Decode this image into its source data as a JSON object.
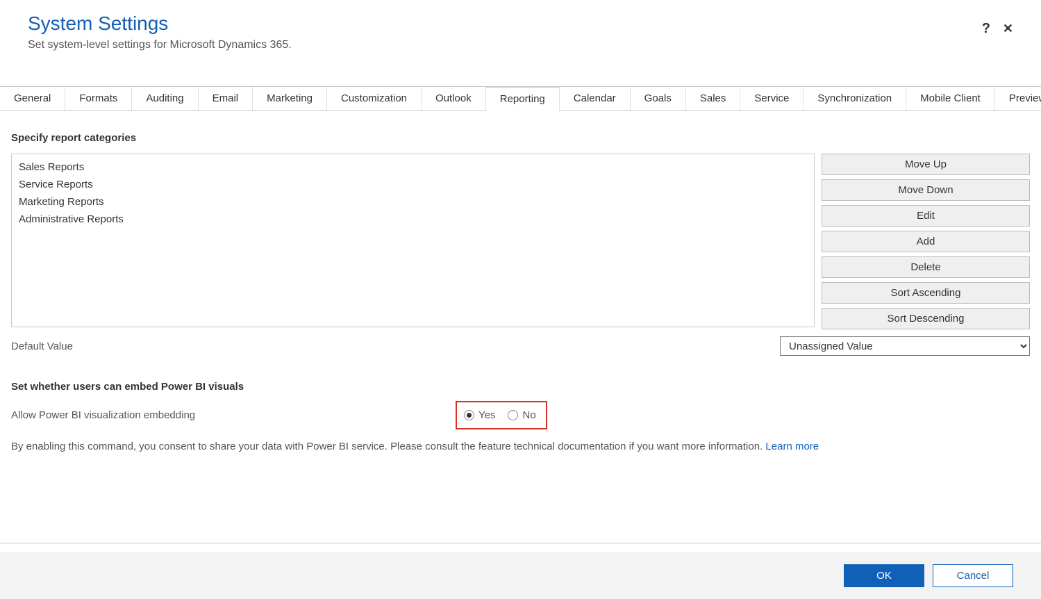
{
  "header": {
    "title": "System Settings",
    "subtitle": "Set system-level settings for Microsoft Dynamics 365.",
    "help": "?",
    "close": "✕"
  },
  "tabs": [
    {
      "label": "General"
    },
    {
      "label": "Formats"
    },
    {
      "label": "Auditing"
    },
    {
      "label": "Email"
    },
    {
      "label": "Marketing"
    },
    {
      "label": "Customization"
    },
    {
      "label": "Outlook"
    },
    {
      "label": "Reporting",
      "active": true
    },
    {
      "label": "Calendar"
    },
    {
      "label": "Goals"
    },
    {
      "label": "Sales"
    },
    {
      "label": "Service"
    },
    {
      "label": "Synchronization"
    },
    {
      "label": "Mobile Client"
    },
    {
      "label": "Previews"
    }
  ],
  "report": {
    "heading": "Specify report categories",
    "items": [
      "Sales Reports",
      "Service Reports",
      "Marketing Reports",
      "Administrative Reports"
    ],
    "buttons": {
      "move_up": "Move Up",
      "move_down": "Move Down",
      "edit": "Edit",
      "add": "Add",
      "delete": "Delete",
      "sort_asc": "Sort Ascending",
      "sort_desc": "Sort Descending"
    },
    "default_label": "Default Value",
    "default_value": "Unassigned Value"
  },
  "powerbi": {
    "heading": "Set whether users can embed Power BI visuals",
    "label": "Allow Power BI visualization embedding",
    "yes": "Yes",
    "no": "No",
    "selected": "yes",
    "consent": "By enabling this command, you consent to share your data with Power BI service. Please consult the feature technical documentation if you want more information. ",
    "learn_more": "Learn more"
  },
  "footer": {
    "ok": "OK",
    "cancel": "Cancel"
  }
}
